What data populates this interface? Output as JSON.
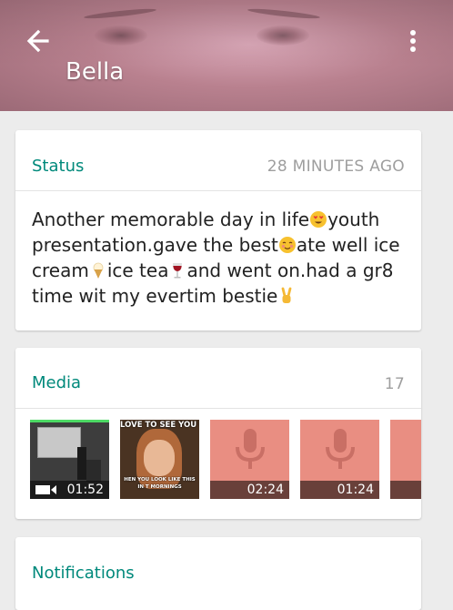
{
  "header": {
    "title": "Bella",
    "back_icon": "arrow-left-icon",
    "menu_icon": "more-vert-icon"
  },
  "status": {
    "label": "Status",
    "time": "28 MINUTES AGO",
    "segments": [
      {
        "type": "text",
        "value": "Another memorable day in life"
      },
      {
        "type": "emoji",
        "name": "heart-eyes-emoji"
      },
      {
        "type": "text",
        "value": "youth presentation.gave the best"
      },
      {
        "type": "emoji",
        "name": "smiling-blush-emoji"
      },
      {
        "type": "text",
        "value": "ate well ice cream"
      },
      {
        "type": "emoji",
        "name": "ice-cream-emoji"
      },
      {
        "type": "text",
        "value": "ice tea"
      },
      {
        "type": "emoji",
        "name": "wine-glass-emoji"
      },
      {
        "type": "text",
        "value": "and went on.had a gr8 time wit my evertim bestie"
      },
      {
        "type": "emoji",
        "name": "victory-hand-emoji"
      }
    ]
  },
  "media": {
    "label": "Media",
    "count": "17",
    "items": [
      {
        "kind": "video",
        "duration": "01:52"
      },
      {
        "kind": "image",
        "caption_top": "LOVE TO SEE YOU GIR",
        "caption_bottom": "HEN YOU LOOK LIKE THIS IN T MORNINGS"
      },
      {
        "kind": "audio",
        "duration": "02:24"
      },
      {
        "kind": "audio",
        "duration": "01:24"
      },
      {
        "kind": "audio",
        "duration": ""
      }
    ]
  },
  "notifications": {
    "label": "Notifications"
  },
  "colors": {
    "accent": "#00897b",
    "audio_bg": "#e98e82",
    "header_tint": "#b9818f"
  }
}
